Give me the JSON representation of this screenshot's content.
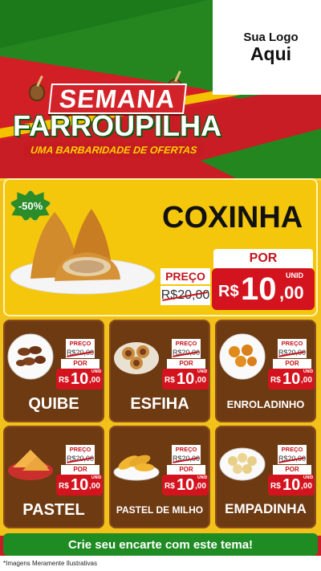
{
  "logo": {
    "line1": "Sua Logo",
    "line2": "Aqui"
  },
  "title": {
    "semana": "SEMANA",
    "farroupilha": "FARROUPILHA",
    "subtitle": "UMA BARBARIDADE DE OFERTAS"
  },
  "hero": {
    "discount": "-50%",
    "name": "COXINHA",
    "preco_label": "PREÇO",
    "old_price": "R$20,00",
    "por_label": "POR",
    "unit_label": "UNID",
    "new_price_currency": "R$",
    "new_price_main": "10",
    "new_price_cents": ",00"
  },
  "products": [
    {
      "name": "QUIBE",
      "preco_label": "PREÇO",
      "old_price": "R$20,00",
      "por_label": "POR",
      "currency": "R$",
      "main": "10",
      "cents": ",00",
      "unit": "UNID"
    },
    {
      "name": "ESFIHA",
      "preco_label": "PREÇO",
      "old_price": "R$20,00",
      "por_label": "POR",
      "currency": "R$",
      "main": "10",
      "cents": ",00",
      "unit": "UNID"
    },
    {
      "name": "ENROLADINHO",
      "preco_label": "PREÇO",
      "old_price": "R$20,00",
      "por_label": "POR",
      "currency": "R$",
      "main": "10",
      "cents": ",00",
      "unit": "UNID"
    },
    {
      "name": "PASTEL",
      "preco_label": "PREÇO",
      "old_price": "R$20,00",
      "por_label": "POR",
      "currency": "R$",
      "main": "10",
      "cents": ",00",
      "unit": "UNID"
    },
    {
      "name": "PASTEL DE MILHO",
      "preco_label": "PREÇO",
      "old_price": "R$20,00",
      "por_label": "POR",
      "currency": "R$",
      "main": "10",
      "cents": ",00",
      "unit": "UNID"
    },
    {
      "name": "EMPADINHA",
      "preco_label": "PREÇO",
      "old_price": "R$20,00",
      "por_label": "POR",
      "currency": "R$",
      "main": "10",
      "cents": ",00",
      "unit": "UNID"
    }
  ],
  "cta": "Crie seu encarte com este tema!",
  "disclaimer": "*Imagens Meramente Ilustrativas",
  "colors": {
    "red": "#d3141f",
    "green": "#25861f",
    "yellow": "#f4c60c",
    "brown": "#6e3a12"
  }
}
